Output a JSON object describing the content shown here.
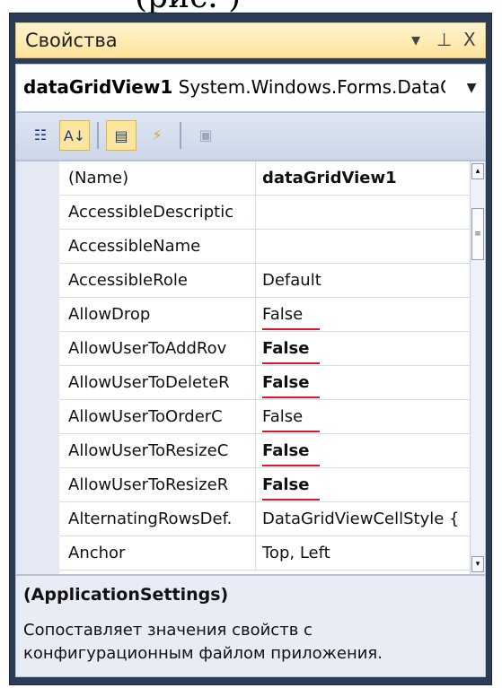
{
  "panel": {
    "title": "Свойства",
    "pin_icon": "pin-icon",
    "close_icon": "close-icon",
    "menu_icon": "dropdown-icon"
  },
  "object_selector": {
    "name": "dataGridView1",
    "type": "System.Windows.Forms.DataGr"
  },
  "toolbar": {
    "buttons": [
      {
        "name": "categorized-icon",
        "active": false
      },
      {
        "name": "alphabetical-icon",
        "active": true
      },
      {
        "name": "properties-icon",
        "active": true
      },
      {
        "name": "events-icon",
        "active": false
      },
      {
        "name": "property-pages-icon",
        "active": false
      }
    ]
  },
  "properties": [
    {
      "name": "(Name)",
      "value": "dataGridView1",
      "bold": true,
      "underline": false
    },
    {
      "name": "AccessibleDescriptic",
      "value": "",
      "bold": false,
      "underline": false
    },
    {
      "name": "AccessibleName",
      "value": "",
      "bold": false,
      "underline": false
    },
    {
      "name": "AccessibleRole",
      "value": "Default",
      "bold": false,
      "underline": false
    },
    {
      "name": "AllowDrop",
      "value": "False",
      "bold": false,
      "underline": true
    },
    {
      "name": "AllowUserToAddRov",
      "value": "False",
      "bold": true,
      "underline": true
    },
    {
      "name": "AllowUserToDeleteR",
      "value": "False",
      "bold": true,
      "underline": true
    },
    {
      "name": "AllowUserToOrderC",
      "value": "False",
      "bold": false,
      "underline": true
    },
    {
      "name": "AllowUserToResizeC",
      "value": "False",
      "bold": true,
      "underline": true
    },
    {
      "name": "AllowUserToResizeR",
      "value": "False",
      "bold": true,
      "underline": true
    },
    {
      "name": "AlternatingRowsDef.",
      "value": "DataGridViewCellStyle {",
      "bold": false,
      "underline": false
    },
    {
      "name": "Anchor",
      "value": "Top, Left",
      "bold": false,
      "underline": false
    }
  ],
  "description": {
    "title": "(ApplicationSettings)",
    "text": "Сопоставляет значения свойств с конфигурационным файлом приложения."
  },
  "colors": {
    "accent_underline": "#d9182b",
    "titlebar": "#ffe39a",
    "frame": "#2b3c59"
  }
}
